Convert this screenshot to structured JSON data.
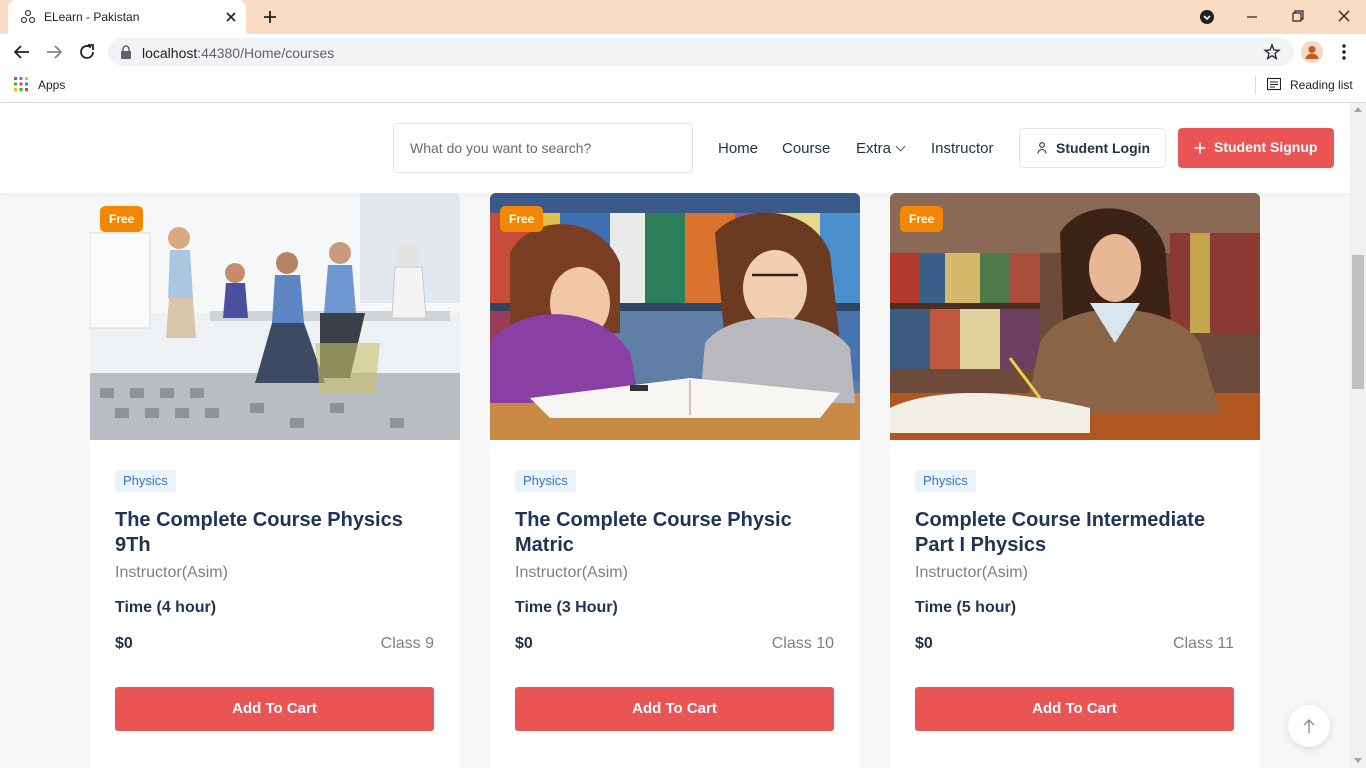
{
  "browser": {
    "tab_title": "ELearn - Pakistan",
    "url_host": "localhost",
    "url_rest": ":44380/Home/courses",
    "bookmarks": {
      "apps_label": "Apps",
      "reading_list_label": "Reading list"
    }
  },
  "header": {
    "search_placeholder": "What do you want to search?",
    "nav": {
      "home": "Home",
      "course": "Course",
      "extra": "Extra",
      "instructor": "Instructor"
    },
    "login_label": "Student Login",
    "signup_label": "Student Signup"
  },
  "courses": [
    {
      "badge": "Free",
      "category": "Physics",
      "title": "The Complete Course Physics 9Th",
      "instructor": "Instructor(Asim)",
      "time": "Time (4 hour)",
      "price": "$0",
      "class": "Class 9",
      "button": "Add To Cart"
    },
    {
      "badge": "Free",
      "category": "Physics",
      "title": "The Complete Course Physic Matric",
      "instructor": "Instructor(Asim)",
      "time": "Time (3 Hour)",
      "price": "$0",
      "class": "Class 10",
      "button": "Add To Cart"
    },
    {
      "badge": "Free",
      "category": "Physics",
      "title": "Complete Course Intermediate Part I Physics",
      "instructor": "Instructor(Asim)",
      "time": "Time (5 hour)",
      "price": "$0",
      "class": "Class 11",
      "button": "Add To Cart"
    }
  ],
  "colors": {
    "accent": "#ea5454",
    "badge": "#f28705",
    "tag_bg": "#ebf3fd",
    "tag_text": "#3b74c7",
    "title_text": "#1f3354",
    "tab_strip": "#fadcc4"
  },
  "icons": {
    "back_to_top": "arrow-up-icon",
    "login": "user-icon",
    "signup": "plus-icon"
  }
}
